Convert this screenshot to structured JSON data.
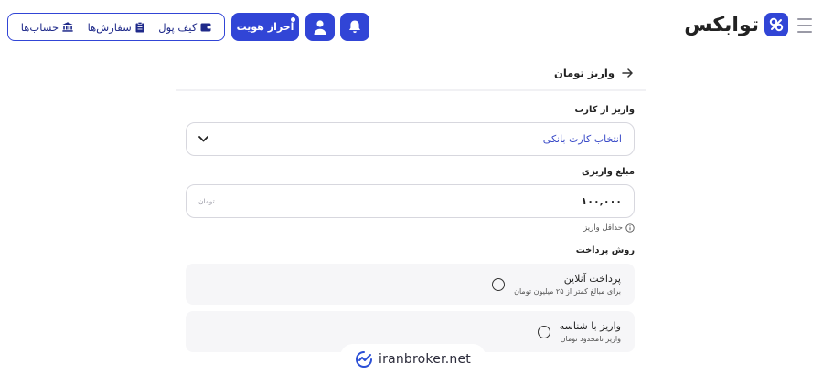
{
  "header": {
    "logo_text": "توابکس",
    "kyc_label": "احراز هویت",
    "nav": [
      {
        "label": "کیف پول",
        "icon": "wallet-icon"
      },
      {
        "label": "سفارش‌ها",
        "icon": "clipboard-icon"
      },
      {
        "label": "حساب‌ها",
        "icon": "bank-icon"
      }
    ]
  },
  "page": {
    "title": "واریز تومان"
  },
  "form": {
    "card_label": "واریز از کارت",
    "card_select_value": "انتخاب کارت بانکی",
    "amount_label": "مبلغ واریزی",
    "amount_value": "۱۰۰,۰۰۰",
    "amount_unit": "تومان",
    "min_hint": "حداقل واریز",
    "method_label": "روش پرداخت",
    "methods": [
      {
        "title": "پرداخت آنلاین",
        "subtitle": "برای مبالغ کمتر از ۲۵ میلیون تومان"
      },
      {
        "title": "واریز با شناسه",
        "subtitle": "واریز نامحدود تومان"
      }
    ]
  },
  "watermark": {
    "text": "iranbroker.net"
  },
  "colors": {
    "primary": "#3145d6",
    "select_text": "#3a4bc8"
  }
}
